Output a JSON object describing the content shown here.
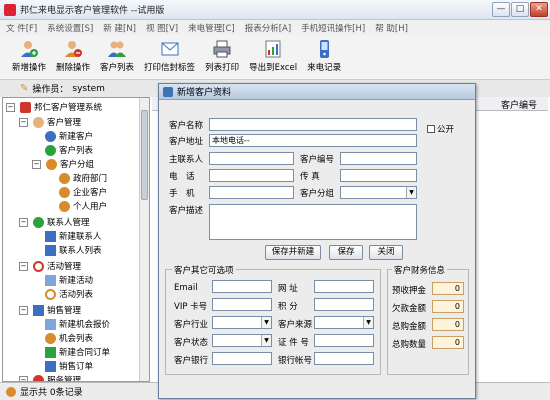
{
  "window": {
    "title": "邦仁来电显示客户管理软件 --试用版",
    "min": "—",
    "max": "□",
    "close": "✕"
  },
  "menu": [
    "文 件[F]",
    "系统设置[S]",
    "新 建[N]",
    "视 图[V]",
    "来电管理[C]",
    "报表分析[A]",
    "手机短讯操作[H]",
    "帮 助[H]"
  ],
  "toolbar": [
    {
      "label": "新增操作",
      "icon": "user-add-icon"
    },
    {
      "label": "删除操作",
      "icon": "user-delete-icon"
    },
    {
      "label": "客户列表",
      "icon": "customer-list-icon"
    },
    {
      "label": "打印信封标签",
      "icon": "envelope-print-icon"
    },
    {
      "label": "列表打印",
      "icon": "printer-icon"
    },
    {
      "label": "导出到Excel",
      "icon": "excel-export-icon"
    },
    {
      "label": "来电记录",
      "icon": "phone-record-icon"
    }
  ],
  "operator": {
    "label": "操作员：",
    "value": "system"
  },
  "tree": {
    "root": "邦仁客户管理系统",
    "items": [
      {
        "label": "客户管理"
      },
      {
        "label": "新建客户"
      },
      {
        "label": "客户列表"
      },
      {
        "label": "客户分组"
      },
      {
        "label": "政府部门"
      },
      {
        "label": "企业客户"
      },
      {
        "label": "个人用户"
      },
      {
        "label": "联系人管理"
      },
      {
        "label": "新建联系人"
      },
      {
        "label": "联系人列表"
      },
      {
        "label": "活动管理"
      },
      {
        "label": "新建活动"
      },
      {
        "label": "活动列表"
      },
      {
        "label": "销售管理"
      },
      {
        "label": "新建机会报价"
      },
      {
        "label": "机会列表"
      },
      {
        "label": "新建合同订单"
      },
      {
        "label": "销售订单"
      },
      {
        "label": "服务管理"
      }
    ]
  },
  "right_pane": {
    "col_header": "客户编号"
  },
  "status": {
    "text": "显示共 0条记录"
  },
  "dialog": {
    "title": "新增客户资料",
    "fields": {
      "name_label": "客户名称",
      "name_value": "",
      "public_label": "公开",
      "address_label": "客户地址",
      "address_value": "本地电话--",
      "contact_label": "主联系人",
      "contact_value": "",
      "code_label": "客户编号",
      "code_value": "",
      "phone_label": "电　话",
      "phone_value": "",
      "fax_label": "传 真",
      "fax_value": "",
      "mobile_label": "手　机",
      "mobile_value": "",
      "group_label": "客户分组",
      "group_value": "",
      "desc_label": "客户描述",
      "desc_value": ""
    },
    "buttons": {
      "save_new": "保存并新建",
      "save": "保存",
      "close": "关闭"
    },
    "other": {
      "legend": "客户其它可选项",
      "email_label": "Email",
      "website_label": "网 址",
      "vip_label": "VIP 卡号",
      "points_label": "积 分",
      "industry_label": "客户行业",
      "source_label": "客户来源",
      "status_label": "客户状态",
      "id_label": "证 件 号",
      "bank_label": "客户银行",
      "account_label": "银行帐号"
    },
    "finance": {
      "legend": "客户财务信息",
      "items": [
        {
          "label": "预收押金",
          "value": "0"
        },
        {
          "label": "欠款金额",
          "value": "0"
        },
        {
          "label": "总购金额",
          "value": "0"
        },
        {
          "label": "总购数量",
          "value": "0"
        }
      ]
    }
  }
}
